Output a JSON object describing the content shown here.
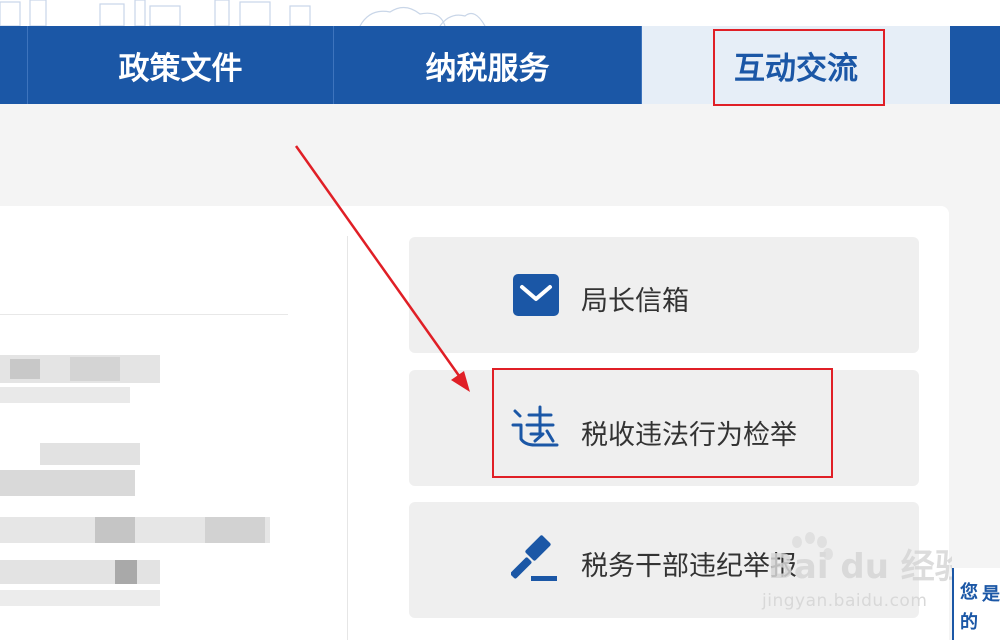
{
  "nav": {
    "items": [
      {
        "label": ""
      },
      {
        "label": "政策文件"
      },
      {
        "label": "纳税服务"
      },
      {
        "label": "互动交流"
      },
      {
        "label": ""
      }
    ],
    "active_index": 3
  },
  "services": [
    {
      "label": "局长信箱",
      "icon": "mail-icon"
    },
    {
      "label": "税收违法行为检举",
      "icon": "tax-violation-report-icon"
    },
    {
      "label": "税务干部违纪举报",
      "icon": "gavel-icon"
    }
  ],
  "watermark": {
    "logo_text": "Bai du 经验",
    "url": "jingyan.baidu.com"
  },
  "side_tab": {
    "chars": [
      "您",
      "的",
      "是"
    ]
  },
  "colors": {
    "nav_blue": "#1b57a6",
    "active_tab_bg": "#e6eef7",
    "highlight_red": "#e01f26",
    "page_bg": "#f4f4f4"
  }
}
